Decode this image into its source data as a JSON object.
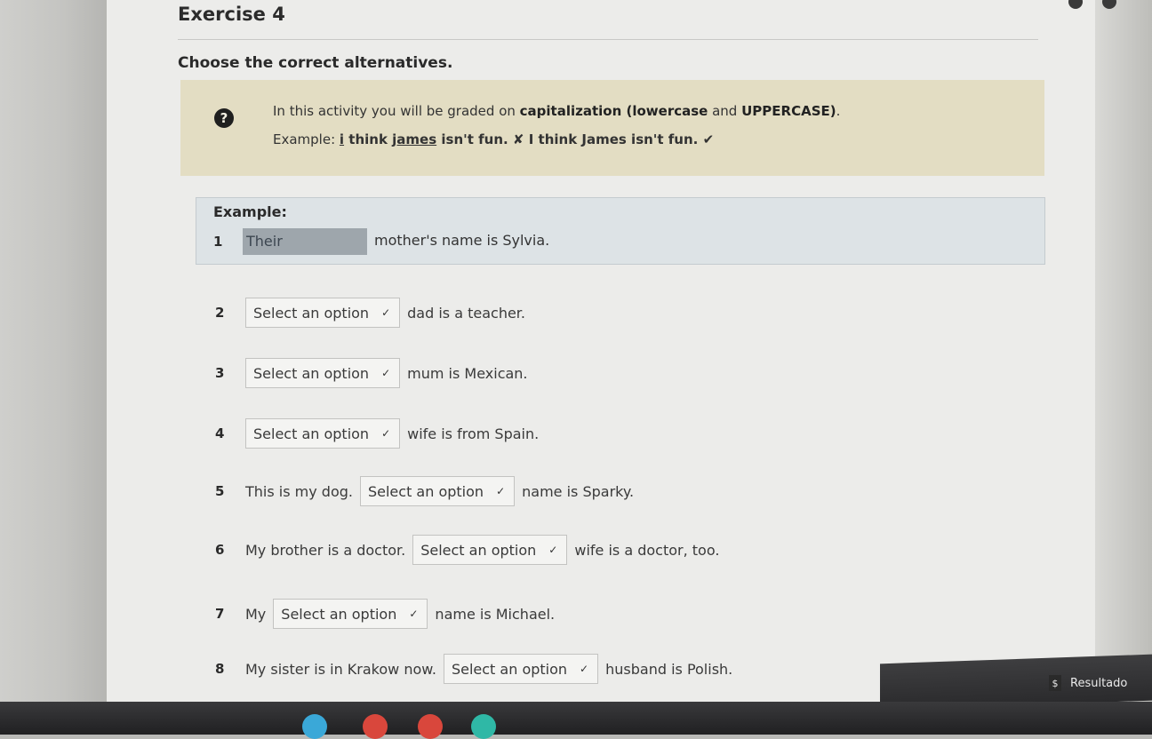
{
  "exercise_title": "Exercise 4",
  "instruction": "Choose the correct alternatives.",
  "note": {
    "help_icon": "?",
    "line1_prefix": "In this activity you will be graded on ",
    "line1_bold": "capitalization (lowercase",
    "line1_mid": " and ",
    "line1_bold2": "UPPERCASE)",
    "line1_suffix": ".",
    "line2_prefix": "Example: ",
    "wrong_i": "i",
    "wrong_think": " think ",
    "wrong_james": "james",
    "wrong_rest": " isn't fun.",
    "cross": " ✘ ",
    "correct": "I think James isn't fun.",
    "check": " ✔"
  },
  "example": {
    "heading": "Example:",
    "number": "1",
    "answer": "Their",
    "text": "mother's name is Sylvia."
  },
  "select_placeholder": "Select an option",
  "questions": [
    {
      "number": "2",
      "pre": "",
      "post": "dad is a teacher."
    },
    {
      "number": "3",
      "pre": "",
      "post": "mum is Mexican."
    },
    {
      "number": "4",
      "pre": "",
      "post": "wife is from Spain."
    },
    {
      "number": "5",
      "pre": "This is my dog.",
      "post": "name is Sparky."
    },
    {
      "number": "6",
      "pre": "My brother is a doctor.",
      "post": "wife is a doctor, too."
    },
    {
      "number": "7",
      "pre": "My",
      "post": "name is Michael."
    },
    {
      "number": "8",
      "pre": "My sister is in Krakow now.",
      "post": "husband is Polish."
    }
  ],
  "result_button": "Resultado",
  "colors": {
    "note_bg": "#e3ddc3",
    "example_bg": "#dde3e6",
    "answer_bg": "#9ea6ac"
  }
}
